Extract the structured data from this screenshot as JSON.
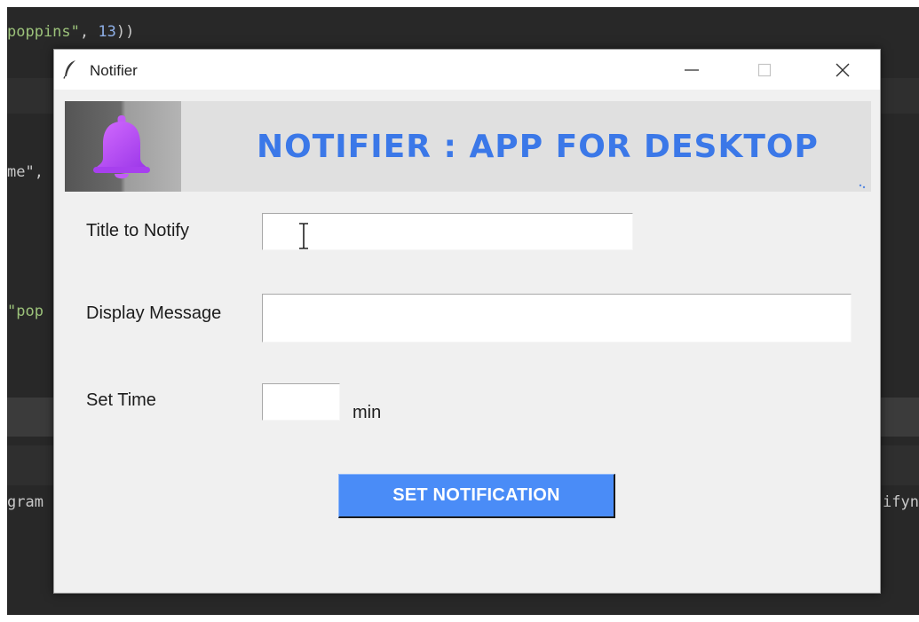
{
  "editor": {
    "lines": {
      "l1_str": "poppins\"",
      "l1_punc": ",",
      "l1_num": "13",
      "l1_end": "))",
      "l2": "me\",",
      "l3": "\"pop",
      "l4_left": "gram",
      "l4_right": "ifyn"
    }
  },
  "window": {
    "title": "Notifier",
    "icon": "feather-icon",
    "controls": [
      "minimize-icon",
      "maximize-icon",
      "close-icon"
    ]
  },
  "banner": {
    "title": "NOTIFIER : APP  FOR  DESKTOP",
    "icon": "bell-icon",
    "title_color": "#3b78e8",
    "bell_color": "#b54df2"
  },
  "form": {
    "title_label": "Title to Notify",
    "title_value": "",
    "message_label": "Display Message",
    "message_value": "",
    "time_label": "Set Time",
    "time_value": "",
    "time_unit": "min",
    "submit_label": "SET NOTIFICATION",
    "submit_color": "#4a8cf7"
  }
}
